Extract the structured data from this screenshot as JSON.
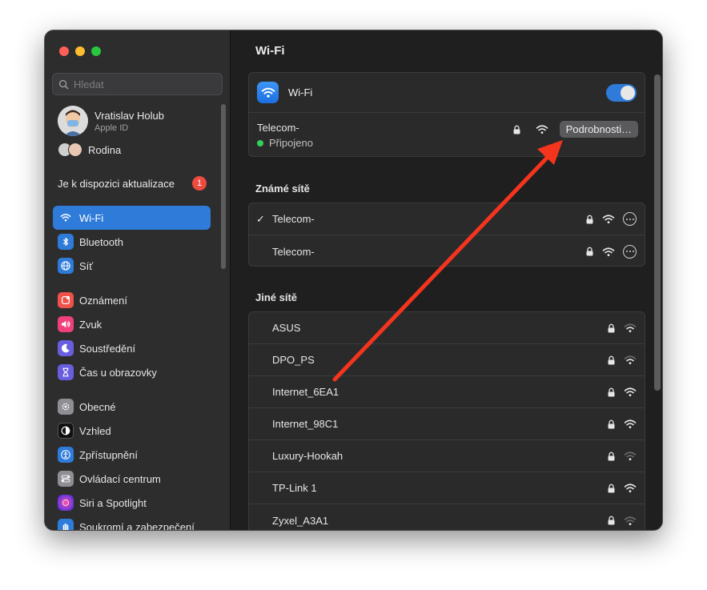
{
  "sidebar": {
    "search_placeholder": "Hledat",
    "profile": {
      "name": "Vratislav Holub",
      "subtitle": "Apple ID"
    },
    "family_label": "Rodina",
    "update": {
      "label": "Je k dispozici aktualizace",
      "badge": "1"
    },
    "items": [
      {
        "label": "Wi-Fi",
        "icon": "wifi-icon",
        "color": "#2f7bd9",
        "active": true
      },
      {
        "label": "Bluetooth",
        "icon": "bluetooth-icon",
        "color": "#2f7bd9"
      },
      {
        "label": "Síť",
        "icon": "globe-icon",
        "color": "#2f7bd9"
      },
      {
        "label": "Oznámení",
        "icon": "bell-icon",
        "color": "#f0524a"
      },
      {
        "label": "Zvuk",
        "icon": "speaker-icon",
        "color": "#f0407a"
      },
      {
        "label": "Soustředění",
        "icon": "moon-icon",
        "color": "#6a5de0"
      },
      {
        "label": "Čas u obrazovky",
        "icon": "hourglass-icon",
        "color": "#6a5de0"
      },
      {
        "label": "Obecné",
        "icon": "gear-icon",
        "color": "#8e8e93"
      },
      {
        "label": "Vzhled",
        "icon": "appearance-icon",
        "color": "#111111"
      },
      {
        "label": "Zpřístupnění",
        "icon": "accessibility-icon",
        "color": "#2f7bd9"
      },
      {
        "label": "Ovládací centrum",
        "icon": "toggles-icon",
        "color": "#8e8e93"
      },
      {
        "label": "Siri a Spotlight",
        "icon": "siri-icon",
        "color": "#c23fd6"
      },
      {
        "label": "Soukromí a zabezpečení",
        "icon": "hand-icon",
        "color": "#2f7bd9"
      }
    ]
  },
  "main": {
    "title": "Wi-Fi",
    "wifi_label": "Wi-Fi",
    "wifi_enabled": true,
    "current_network": {
      "name": "Telecom-",
      "status": "Připojeno",
      "details_button": "Podrobnosti…"
    },
    "known_title": "Známé sítě",
    "known_networks": [
      {
        "name": "Telecom-",
        "connected": true,
        "locked": true,
        "signal": "strong"
      },
      {
        "name": "Telecom-",
        "connected": false,
        "locked": true,
        "signal": "strong"
      }
    ],
    "other_title": "Jiné sítě",
    "other_networks": [
      {
        "name": "ASUS",
        "locked": true,
        "signal": "medium"
      },
      {
        "name": "DPO_PS",
        "locked": true,
        "signal": "medium"
      },
      {
        "name": "Internet_6EA1",
        "locked": true,
        "signal": "strong"
      },
      {
        "name": "Internet_98C1",
        "locked": true,
        "signal": "strong"
      },
      {
        "name": "Luxury-Hookah",
        "locked": true,
        "signal": "weak"
      },
      {
        "name": "TP-Link 1",
        "locked": true,
        "signal": "strong"
      },
      {
        "name": "Zyxel_A3A1",
        "locked": true,
        "signal": "weak"
      }
    ]
  },
  "annotation": {
    "arrow_color": "#f5341e"
  }
}
